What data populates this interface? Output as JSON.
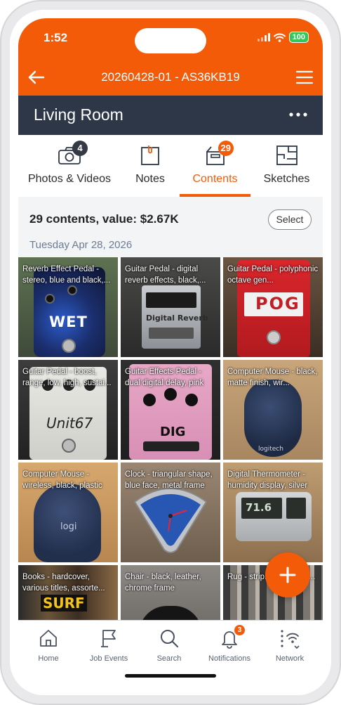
{
  "status_bar": {
    "time": "1:52",
    "battery": "100"
  },
  "header": {
    "title": "20260428-01 - AS36KB19"
  },
  "room": {
    "title": "Living Room"
  },
  "tabs": [
    {
      "label": "Photos & Videos",
      "badge": "4",
      "icon": "camera-icon"
    },
    {
      "label": "Notes",
      "badge": "",
      "icon": "notes-icon"
    },
    {
      "label": "Contents",
      "badge": "29",
      "icon": "box-icon",
      "active": true
    },
    {
      "label": "Sketches",
      "badge": "",
      "icon": "floorplan-icon"
    }
  ],
  "summary": {
    "text": "29 contents, value: $2.67K",
    "select_label": "Select",
    "date": "Tuesday Apr 28, 2026"
  },
  "items": [
    {
      "label": "Reverb Effect Pedal - stereo, blue and black,...",
      "photo_text": "WET"
    },
    {
      "label": "Guitar Pedal - digital reverb effects, black,...",
      "photo_text": "Digital Reverb"
    },
    {
      "label": "Guitar Pedal - polyphonic octave gen...",
      "photo_text": "POG"
    },
    {
      "label": "Guitar Pedal - boost, range, low, high, sustai...",
      "photo_text": "Unit67"
    },
    {
      "label": "Guitar Effects Pedal - dual digital delay, pink",
      "photo_text": "DIG"
    },
    {
      "label": "Computer Mouse - black, matte finish, wir...",
      "photo_text": "logitech"
    },
    {
      "label": "Computer Mouse - wireless, black, plastic",
      "photo_text": "logi"
    },
    {
      "label": "Clock - triangular shape, blue face, metal frame",
      "photo_text": ""
    },
    {
      "label": "Digital Thermometer - humidity display, silver",
      "photo_text": "71.6"
    },
    {
      "label": "Books - hardcover, various titles, assorte...",
      "photo_text": "SURF"
    },
    {
      "label": "Chair - black, leather, chrome frame",
      "photo_text": ""
    },
    {
      "label": "Rug - strip... black, gra...",
      "photo_text": ""
    }
  ],
  "fab": {
    "icon": "plus-icon"
  },
  "bottom_nav": [
    {
      "label": "Home",
      "icon": "home-icon"
    },
    {
      "label": "Job Events",
      "icon": "flag-icon"
    },
    {
      "label": "Search",
      "icon": "search-icon"
    },
    {
      "label": "Notifications",
      "icon": "bell-icon",
      "badge": "3"
    },
    {
      "label": "Network",
      "icon": "network-icon"
    }
  ],
  "colors": {
    "brand": "#f45b08",
    "room_bar": "#2d3748",
    "battery": "#33c759"
  }
}
